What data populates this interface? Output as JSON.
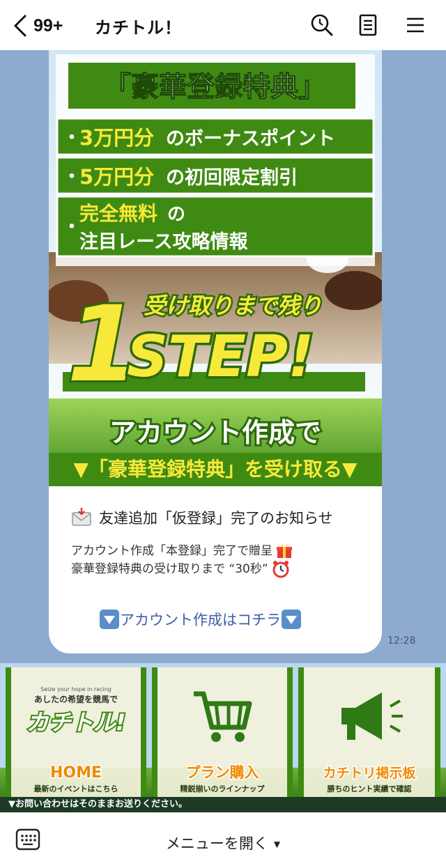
{
  "header": {
    "unread_count": "99+",
    "title": "カチトル！"
  },
  "banner": {
    "heading": "「豪華登録特典」",
    "benefit1_highlight": "3万円分",
    "benefit1_rest": "のボーナスポイント",
    "benefit2_highlight": "5万円分",
    "benefit2_rest": "の初回限定割引",
    "benefit3_highlight": "完全無料",
    "benefit3_rest1": "の",
    "benefit3_rest2": "注目レース攻略情報",
    "remain_text": "受け取りまで残り",
    "step_number": "1",
    "step_word": "STEP!",
    "account_line": "アカウント作成で",
    "receive_line": "▼「豪華登録特典」を受け取る▼"
  },
  "message": {
    "title": "友達追加「仮登録」完了のお知らせ",
    "line1": "アカウント作成「本登録」完了で贈呈",
    "line2": "豪華登録特典の受け取りまで “30秒”",
    "link_label": "アカウント作成はコチラ",
    "time": "12:28"
  },
  "richmenu": {
    "logo_tagline": "Seize your hope in racing",
    "logo_sub": "あしたの希望を競馬で",
    "logo_main": "カチトル!",
    "home_label": "HOME",
    "home_sub": "最新のイベントはこちら",
    "plan_label": "プラン購入",
    "plan_sub": "精鋭揃いのラインナップ",
    "board_label": "カチトリ掲示板",
    "board_sub": "勝ちのヒント実績で確認",
    "footer": "▼お問い合わせはそのままお送りください。"
  },
  "bottom": {
    "menu_label": "メニューを開く"
  },
  "colors": {
    "chat_bg": "#8eaacf",
    "green": "#3f8a12",
    "yellow": "#f7e93a",
    "link": "#3d5fa8"
  }
}
